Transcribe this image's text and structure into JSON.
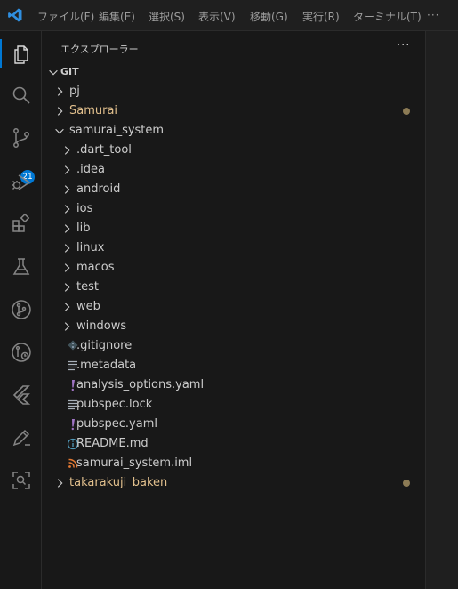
{
  "titlebar": {
    "menu": [
      {
        "label": "ファイル(F)"
      },
      {
        "label": "編集(E)"
      },
      {
        "label": "選択(S)"
      },
      {
        "label": "表示(V)"
      },
      {
        "label": "移動(G)"
      },
      {
        "label": "実行(R)"
      },
      {
        "label": "ターミナル(T)"
      }
    ],
    "more": "···"
  },
  "activity_bar": {
    "items": [
      {
        "name": "explorer-icon",
        "active": true
      },
      {
        "name": "search-icon"
      },
      {
        "name": "source-control-icon",
        "badge": "21"
      },
      {
        "name": "run-debug-icon"
      },
      {
        "name": "extensions-icon"
      },
      {
        "name": "testing-icon"
      },
      {
        "name": "git-graph-icon"
      },
      {
        "name": "git-history-icon"
      },
      {
        "name": "flutter-icon"
      },
      {
        "name": "pen-icon"
      },
      {
        "name": "scan-icon"
      }
    ],
    "accent": "#0078d4"
  },
  "sidebar": {
    "title": "エクスプローラー",
    "more": "···",
    "section": "GIT",
    "tree": [
      {
        "label": "pj",
        "type": "folder",
        "depth": 0,
        "expanded": false
      },
      {
        "label": "Samurai",
        "type": "folder",
        "depth": 0,
        "expanded": false,
        "modified": true
      },
      {
        "label": "samurai_system",
        "type": "folder",
        "depth": 0,
        "expanded": true
      },
      {
        "label": ".dart_tool",
        "type": "folder",
        "depth": 1
      },
      {
        "label": ".idea",
        "type": "folder",
        "depth": 1
      },
      {
        "label": "android",
        "type": "folder",
        "depth": 1
      },
      {
        "label": "ios",
        "type": "folder",
        "depth": 1
      },
      {
        "label": "lib",
        "type": "folder",
        "depth": 1
      },
      {
        "label": "linux",
        "type": "folder",
        "depth": 1
      },
      {
        "label": "macos",
        "type": "folder",
        "depth": 1
      },
      {
        "label": "test",
        "type": "folder",
        "depth": 1
      },
      {
        "label": "web",
        "type": "folder",
        "depth": 1
      },
      {
        "label": "windows",
        "type": "folder",
        "depth": 1
      },
      {
        "label": ".gitignore",
        "type": "file",
        "depth": 1,
        "icon": "git-icon"
      },
      {
        "label": ".metadata",
        "type": "file",
        "depth": 1,
        "icon": "lines-icon"
      },
      {
        "label": "analysis_options.yaml",
        "type": "file",
        "depth": 1,
        "icon": "yaml-icon"
      },
      {
        "label": "pubspec.lock",
        "type": "file",
        "depth": 1,
        "icon": "lines-icon"
      },
      {
        "label": "pubspec.yaml",
        "type": "file",
        "depth": 1,
        "icon": "yaml-icon"
      },
      {
        "label": "README.md",
        "type": "file",
        "depth": 1,
        "icon": "info-icon"
      },
      {
        "label": "samurai_system.iml",
        "type": "file",
        "depth": 1,
        "icon": "rss-icon"
      },
      {
        "label": "takarakuji_baken",
        "type": "folder",
        "depth": 0,
        "expanded": false,
        "modified": true
      }
    ],
    "modified_color": "#e2c08d"
  }
}
